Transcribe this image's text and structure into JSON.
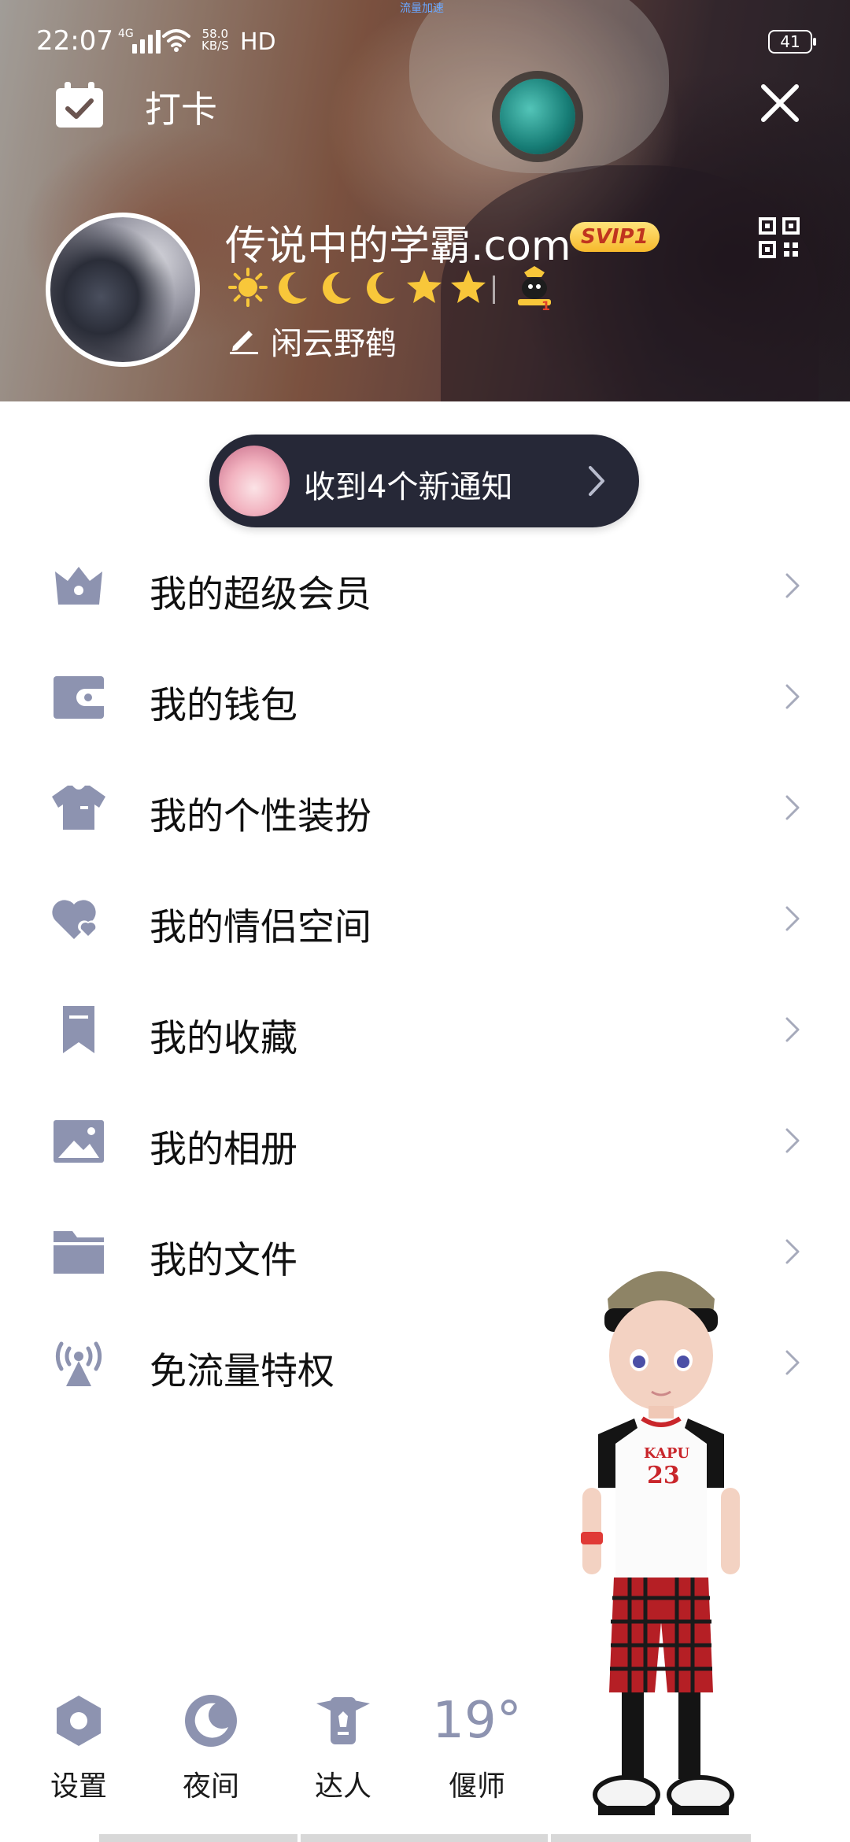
{
  "status_bar": {
    "time": "22:07",
    "network": "4G",
    "speed_value": "58.0",
    "speed_unit": "KB/S",
    "hd": "HD",
    "center_text": "流量加速",
    "battery": "41"
  },
  "header": {
    "checkin_label": "打卡",
    "username": "传说中的学霸.com",
    "svip": "SVIP1",
    "signature": "闲云野鹤",
    "level_icons": [
      "sun-icon",
      "moon-icon",
      "moon-icon",
      "moon-icon",
      "star-icon",
      "star-icon"
    ]
  },
  "notification": {
    "text": "收到4个新通知"
  },
  "menu": {
    "items": [
      {
        "label": "我的超级会员",
        "icon": "crown-icon"
      },
      {
        "label": "我的钱包",
        "icon": "wallet-icon"
      },
      {
        "label": "我的个性装扮",
        "icon": "shirt-icon"
      },
      {
        "label": "我的情侣空间",
        "icon": "hearts-icon"
      },
      {
        "label": "我的收藏",
        "icon": "bookmark-icon"
      },
      {
        "label": "我的相册",
        "icon": "photo-icon"
      },
      {
        "label": "我的文件",
        "icon": "folder-icon"
      },
      {
        "label": "免流量特权",
        "icon": "antenna-icon"
      }
    ]
  },
  "bottom_bar": {
    "settings": "设置",
    "night": "夜间",
    "expert": "达人",
    "weather_temp": "19°",
    "weather_city": "偃师"
  },
  "colors": {
    "icon_gray": "#8d93b0",
    "pill_bg": "#262837",
    "svip_gold": "#f6b92c"
  }
}
